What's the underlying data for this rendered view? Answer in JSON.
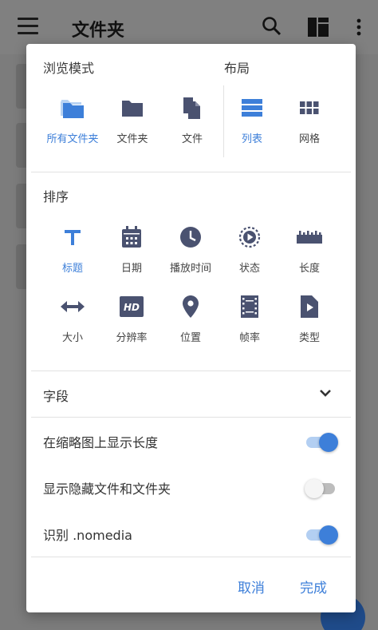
{
  "appbar": {
    "title": "文件夹"
  },
  "dialog": {
    "browse_mode": {
      "label": "浏览模式",
      "options": [
        "所有文件夹",
        "文件夹",
        "文件"
      ]
    },
    "layout": {
      "label": "布局",
      "options": [
        "列表",
        "网格"
      ]
    },
    "sort": {
      "label": "排序",
      "options": [
        "标题",
        "日期",
        "播放时间",
        "状态",
        "长度",
        "大小",
        "分辨率",
        "位置",
        "帧率",
        "类型"
      ]
    },
    "fields": {
      "label": "字段"
    },
    "toggles": [
      {
        "label": "在缩略图上显示长度",
        "on": true
      },
      {
        "label": "显示隐藏文件和文件夹",
        "on": false
      },
      {
        "label": "识别 .nomedia",
        "on": true
      }
    ],
    "buttons": {
      "cancel": "取消",
      "done": "完成"
    }
  },
  "colors": {
    "accent": "#3d7fd9",
    "icon": "#4a5270"
  }
}
